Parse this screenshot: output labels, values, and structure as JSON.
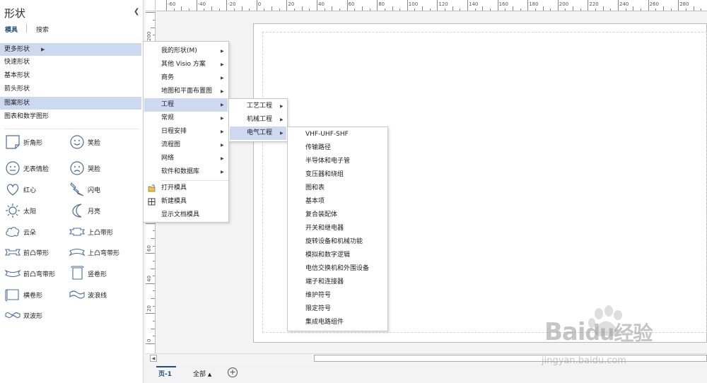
{
  "shapes_pane": {
    "title": "形状",
    "tabs": {
      "stencils": "模具",
      "search": "搜索"
    },
    "categories": [
      {
        "label": "更多形状"
      },
      {
        "label": "快速形状"
      },
      {
        "label": "基本形状"
      },
      {
        "label": "箭头形状"
      },
      {
        "label": "图案形状"
      },
      {
        "label": "图表和数学图形"
      }
    ],
    "shapes": [
      {
        "label": "折角形",
        "icon": "folded-corner-icon"
      },
      {
        "label": "笑脸",
        "icon": "smiley-face-icon"
      },
      {
        "label": "无表情脸",
        "icon": "neutral-face-icon"
      },
      {
        "label": "哭脸",
        "icon": "sad-face-icon"
      },
      {
        "label": "红心",
        "icon": "heart-icon"
      },
      {
        "label": "闪电",
        "icon": "lightning-icon"
      },
      {
        "label": "太阳",
        "icon": "sun-icon"
      },
      {
        "label": "月亮",
        "icon": "moon-icon"
      },
      {
        "label": "云朵",
        "icon": "cloud-icon"
      },
      {
        "label": "上凸带形",
        "icon": "ribbon-up-icon"
      },
      {
        "label": "前凸带形",
        "icon": "ribbon-down-icon"
      },
      {
        "label": "上凸弯带形",
        "icon": "curved-ribbon-up-icon"
      },
      {
        "label": "前凸弯带形",
        "icon": "curved-ribbon-down-icon"
      },
      {
        "label": "竖卷形",
        "icon": "vertical-scroll-icon"
      },
      {
        "label": "横卷形",
        "icon": "horizontal-scroll-icon"
      },
      {
        "label": "波浪线",
        "icon": "wave-icon"
      },
      {
        "label": "双波形",
        "icon": "double-wave-icon"
      }
    ]
  },
  "menu_more_shapes": {
    "items": [
      {
        "label": "我的形状(M)",
        "submenu": true
      },
      {
        "label": "其他 Visio 方案",
        "submenu": true
      },
      {
        "label": "商务",
        "submenu": true
      },
      {
        "label": "地图和平面布置图",
        "submenu": true
      },
      {
        "label": "工程",
        "submenu": true
      },
      {
        "label": "常规",
        "submenu": true
      },
      {
        "label": "日程安排",
        "submenu": true
      },
      {
        "label": "流程图",
        "submenu": true
      },
      {
        "label": "网络",
        "submenu": true
      },
      {
        "label": "软件和数据库",
        "submenu": true
      },
      {
        "label": "打开模具",
        "icon": "open-stencil-icon"
      },
      {
        "label": "新建模具",
        "icon": "new-stencil-icon"
      },
      {
        "label": "显示文档模具"
      }
    ]
  },
  "menu_engineering": {
    "items": [
      {
        "label": "工艺工程"
      },
      {
        "label": "机械工程"
      },
      {
        "label": "电气工程"
      }
    ]
  },
  "menu_electrical": {
    "items": [
      "VHF-UHF-SHF",
      "传输路径",
      "半导体和电子管",
      "变压器和绕组",
      "图和表",
      "基本项",
      "复合装配体",
      "开关和继电器",
      "旋转设备和机械功能",
      "模拟和数字逻辑",
      "电信交换机和外围设备",
      "端子和连接器",
      "维护符号",
      "限定符号",
      "集成电路组件"
    ]
  },
  "ruler": {
    "h_labels": [
      "-60",
      "-40",
      "-20",
      "0",
      "20",
      "40",
      "60",
      "80",
      "100",
      "120",
      "140",
      "160",
      "180",
      "200",
      "220",
      "240",
      "260",
      "280"
    ],
    "v_labels": [
      "0",
      "20",
      "40",
      "60",
      "80",
      "100",
      "120",
      "140",
      "160",
      "180",
      "200",
      "220"
    ]
  },
  "page_tabs": {
    "page1": "页-1",
    "all": "全部",
    "add": "+"
  },
  "watermark": {
    "brand": "Bai",
    "brand_cn": "经验",
    "url": "jingyan.baidu.com"
  },
  "colors": {
    "highlight": "#cdd9f0",
    "accent": "#1f4e79"
  }
}
